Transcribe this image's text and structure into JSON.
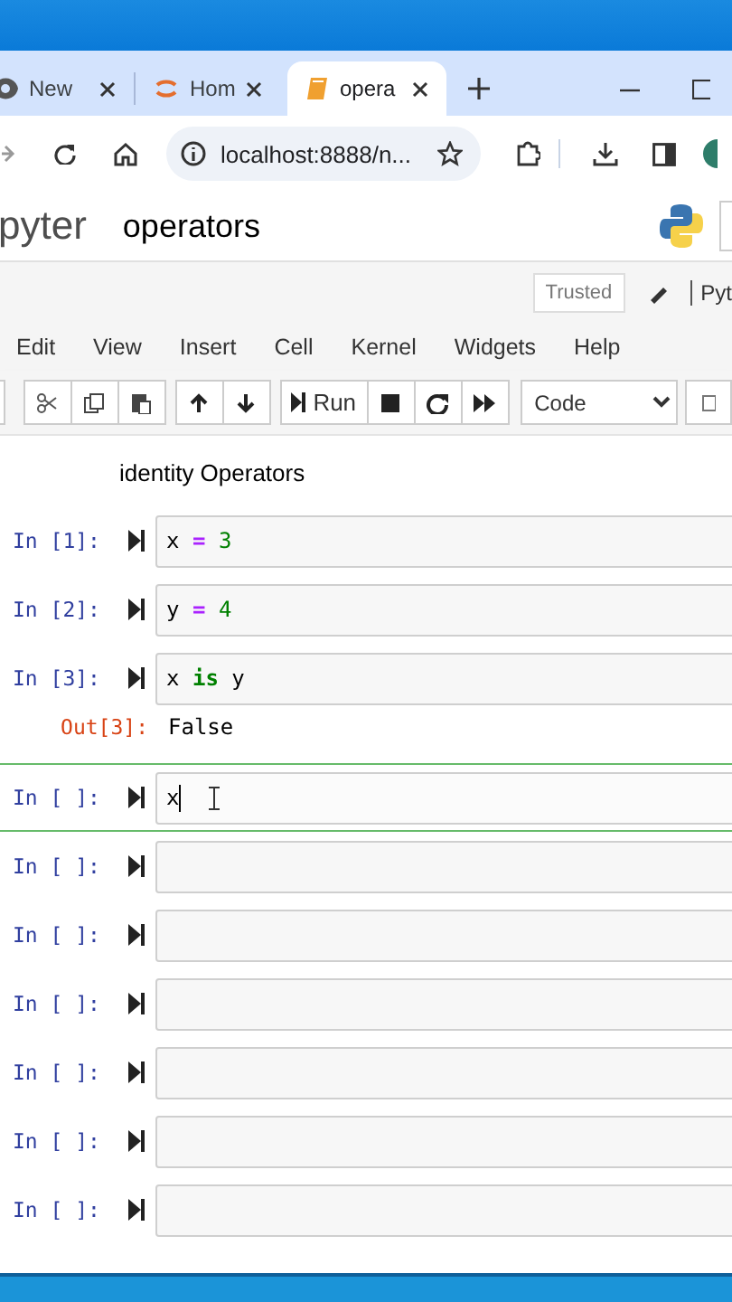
{
  "browser": {
    "tabs": [
      {
        "label": "New",
        "selected": false
      },
      {
        "label": "Hom",
        "selected": false
      },
      {
        "label": "opera",
        "selected": true
      }
    ],
    "address": "localhost:8888/n..."
  },
  "jupyter": {
    "logo_text": "pyter",
    "notebook_title": "operators",
    "trusted": "Trusted",
    "kernel": "Pyt"
  },
  "menu": [
    "Edit",
    "View",
    "Insert",
    "Cell",
    "Kernel",
    "Widgets",
    "Help"
  ],
  "toolbar": {
    "run": "Run",
    "cell_type": "Code"
  },
  "cells": [
    {
      "kind": "markdown",
      "text": "identity Operators",
      "selected": false
    },
    {
      "kind": "code",
      "prompt": "In [1]:",
      "selected": false,
      "code": [
        {
          "text": "x",
          "kind": "name"
        },
        {
          "text": "=",
          "kind": "operator"
        },
        {
          "text": "3",
          "kind": "number"
        }
      ]
    },
    {
      "kind": "code",
      "prompt": "In [2]:",
      "selected": false,
      "code": [
        {
          "text": "y",
          "kind": "name"
        },
        {
          "text": "=",
          "kind": "operator"
        },
        {
          "text": "4",
          "kind": "number"
        }
      ]
    },
    {
      "kind": "code",
      "prompt": "In [3]:",
      "selected": false,
      "code": [
        {
          "text": "x",
          "kind": "name"
        },
        {
          "text": "is",
          "kind": "keyword"
        },
        {
          "text": "y",
          "kind": "name"
        }
      ],
      "output": {
        "prompt": "Out[3]:",
        "text": "False"
      }
    },
    {
      "kind": "code",
      "prompt": "In [ ]:",
      "selected": true,
      "code": [
        {
          "text": "x",
          "kind": "name"
        }
      ]
    },
    {
      "kind": "code",
      "prompt": "In [ ]:",
      "selected": false
    },
    {
      "kind": "code",
      "prompt": "In [ ]:",
      "selected": false
    },
    {
      "kind": "code",
      "prompt": "In [ ]:",
      "selected": false
    },
    {
      "kind": "code",
      "prompt": "In [ ]:",
      "selected": false
    },
    {
      "kind": "code",
      "prompt": "In [ ]:",
      "selected": false
    },
    {
      "kind": "code",
      "prompt": "In [ ]:",
      "selected": false
    }
  ]
}
